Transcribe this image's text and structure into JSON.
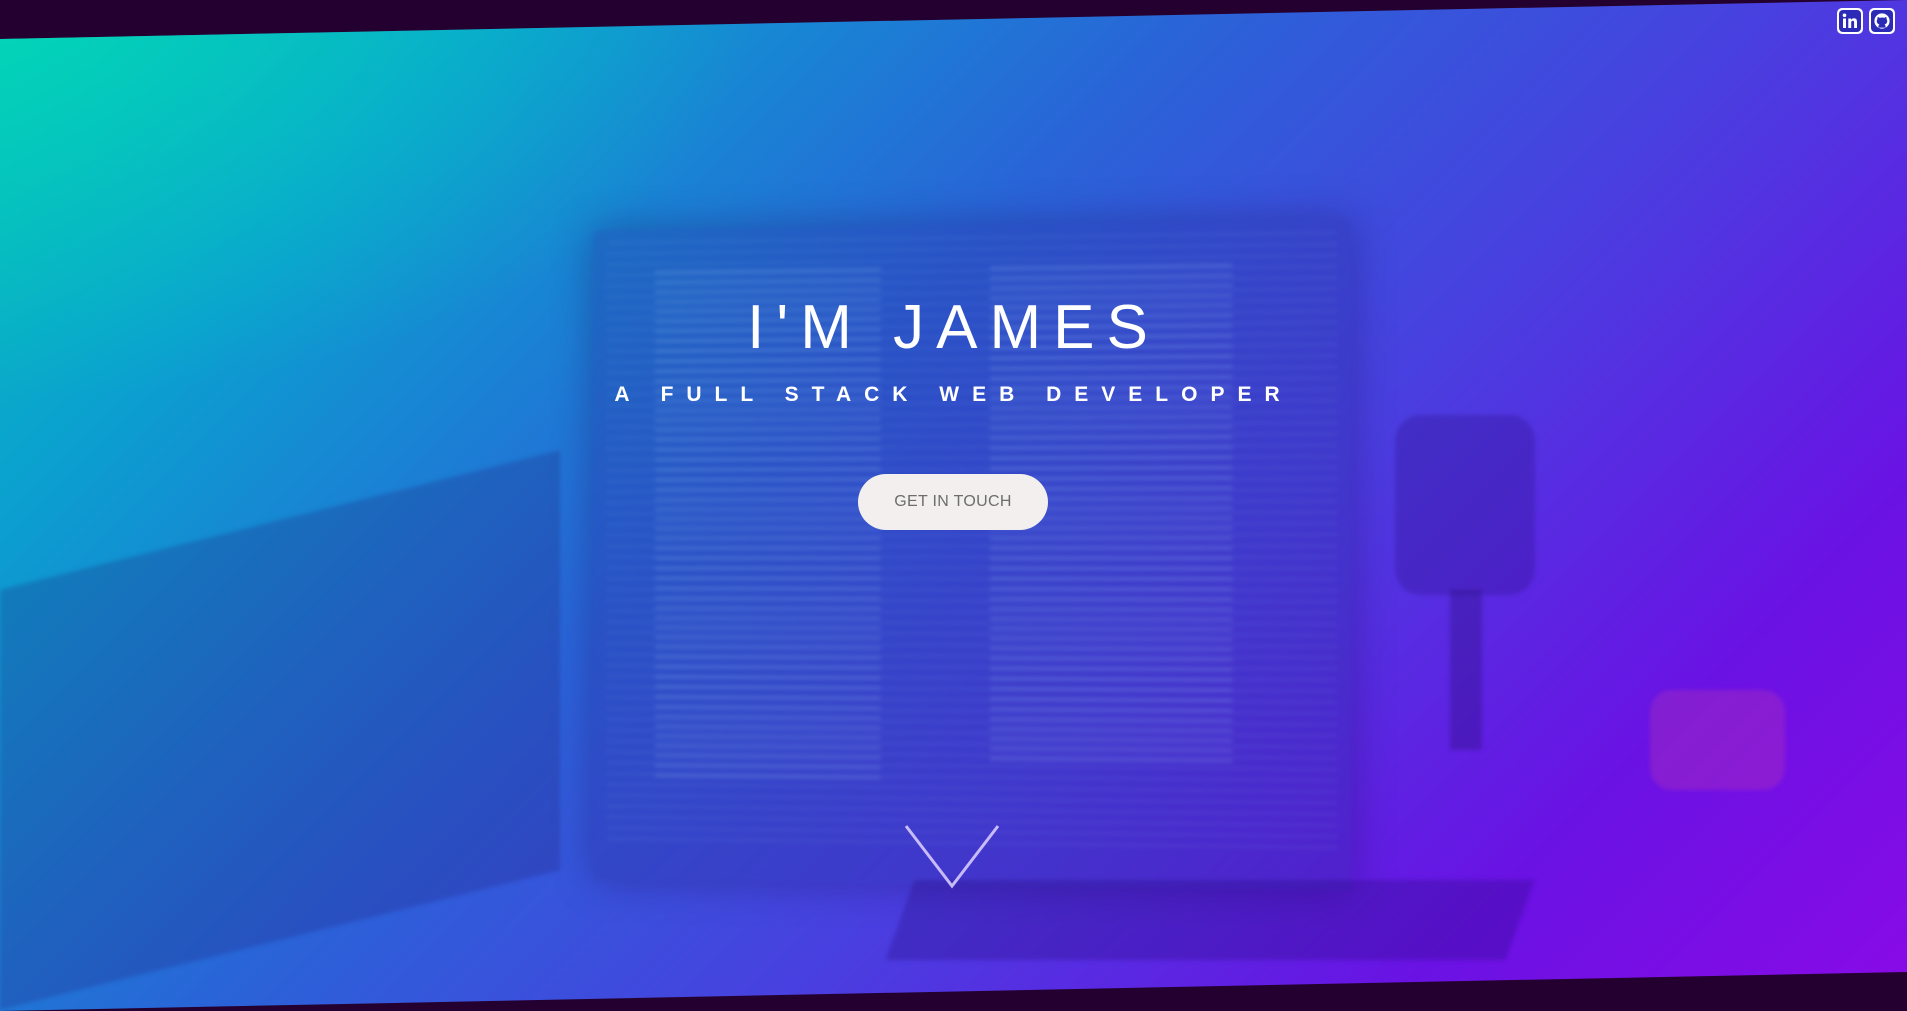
{
  "hero": {
    "title": "I'M JAMES",
    "subtitle": "A FULL STACK WEB DEVELOPER",
    "cta_label": "GET IN TOUCH",
    "scroll_icon": "chevron-down-icon"
  },
  "social": {
    "items": [
      {
        "name": "linkedin",
        "icon": "linkedin-icon"
      },
      {
        "name": "github",
        "icon": "github-icon"
      }
    ]
  },
  "colors": {
    "background_dark": "#23002f",
    "gradient_start": "#05c4b9",
    "gradient_mid": "#2a63d8",
    "gradient_end": "#8a0ae6",
    "button_bg": "#f2efee",
    "button_text": "#6d6d6d",
    "text": "#ffffff"
  }
}
